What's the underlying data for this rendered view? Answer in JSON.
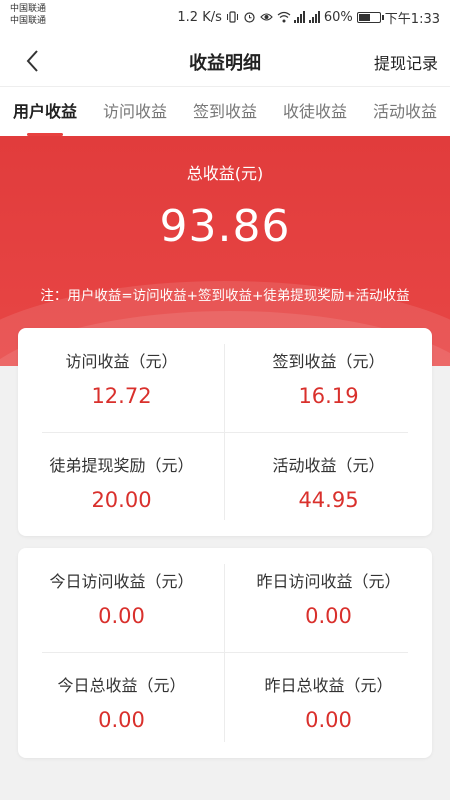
{
  "status_bar": {
    "carrier1": "中国联通",
    "carrier2": "中国联通",
    "speed": "1.2 K/s",
    "battery": "60%",
    "time": "下午1:33",
    "battery_level": 0.6
  },
  "nav": {
    "back_icon": "chevron-left-icon",
    "title": "收益明细",
    "right_action": "提现记录"
  },
  "tabs": [
    {
      "label": "用户收益",
      "active": true
    },
    {
      "label": "访问收益",
      "active": false
    },
    {
      "label": "签到收益",
      "active": false
    },
    {
      "label": "收徒收益",
      "active": false
    },
    {
      "label": "活动收益",
      "active": false
    }
  ],
  "hero": {
    "label": "总收益(元)",
    "amount": "93.86",
    "note": "注：用户收益=访问收益+签到收益+徒弟提现奖励+活动收益"
  },
  "summary": [
    {
      "label": "访问收益（元）",
      "value": "12.72"
    },
    {
      "label": "签到收益（元）",
      "value": "16.19"
    },
    {
      "label": "徒弟提现奖励（元）",
      "value": "20.00"
    },
    {
      "label": "活动收益（元）",
      "value": "44.95"
    }
  ],
  "daily": [
    {
      "label": "今日访问收益（元）",
      "value": "0.00"
    },
    {
      "label": "昨日访问收益（元）",
      "value": "0.00"
    },
    {
      "label": "今日总收益（元）",
      "value": "0.00"
    },
    {
      "label": "昨日总收益（元）",
      "value": "0.00"
    }
  ],
  "colors": {
    "accent": "#e8413f",
    "value_red": "#d9302c"
  }
}
